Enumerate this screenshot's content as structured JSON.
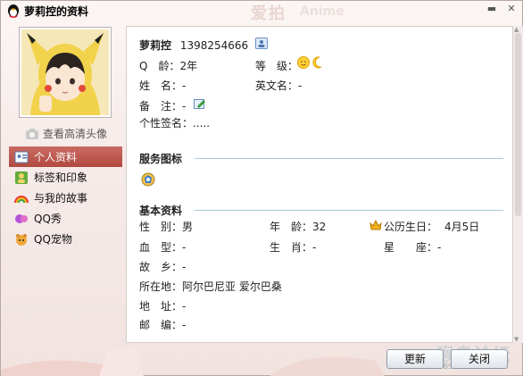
{
  "window": {
    "title": "萝莉控的资料",
    "watermark_top": "爱拍",
    "watermark_top2": "Anime"
  },
  "sidebar": {
    "hd_link": "查看高清头像",
    "items": [
      {
        "label": "个人资料",
        "icon": "profile-card-icon",
        "active": true
      },
      {
        "label": "标签和印象",
        "icon": "tag-icon",
        "active": false
      },
      {
        "label": "与我的故事",
        "icon": "rainbow-icon",
        "active": false
      },
      {
        "label": "QQ秀",
        "icon": "qqshow-icon",
        "active": false
      },
      {
        "label": "QQ宠物",
        "icon": "pet-icon",
        "active": false
      }
    ]
  },
  "profile": {
    "nickname": "萝莉控",
    "qq_number": "1398254666",
    "qage_label": "Q　龄：",
    "qage_value": "2年",
    "level_label": "等　级：",
    "name_label": "姓　名：",
    "name_value": "-",
    "english_label": "英文名：",
    "english_value": "-",
    "remark_label": "备　注：",
    "remark_value": "-",
    "signature_label": "个性签名：",
    "signature_value": "....."
  },
  "service": {
    "title": "服务图标"
  },
  "basic": {
    "title": "基本资料",
    "gender_label": "性　别：",
    "gender_value": "男",
    "age_label": "年　龄：",
    "age_value": "32",
    "birthday_label": "公历生日：",
    "birthday_value": "4月5日",
    "blood_label": "血　型：",
    "blood_value": "-",
    "zodiac_label": "生　肖：",
    "zodiac_value": "-",
    "constellation_label": "星　　座：",
    "constellation_value": "-",
    "hometown_label": "故　乡：",
    "hometown_value": "-",
    "location_label": "所在地：",
    "location_value": "阿尔巴尼亚 爱尔巴桑",
    "address_label": "地　址：",
    "address_value": "-",
    "postcode_label": "邮　编：",
    "postcode_value": "-"
  },
  "buttons": {
    "update": "更新",
    "close": "关闭"
  },
  "watermark_bottom": {
    "big": "猴岛论坛",
    "small": "BBS.HOUDAO.COM"
  },
  "colors": {
    "accent_active": "#b14a40",
    "section_line": "#a8c9d8"
  }
}
